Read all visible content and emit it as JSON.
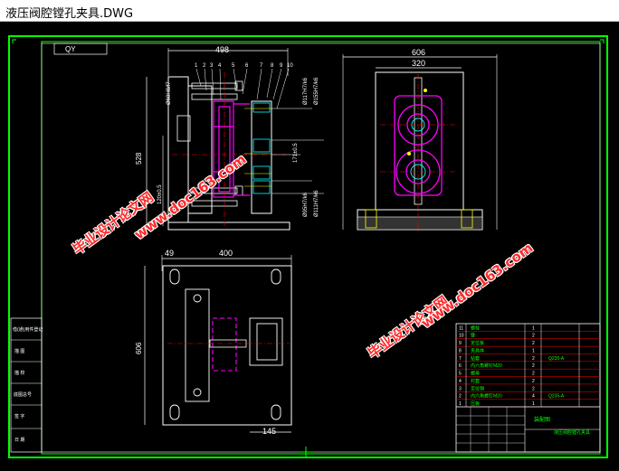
{
  "window": {
    "title": "液压阀腔镗孔夹具.DWG"
  },
  "drawing": {
    "view_label": "QY",
    "front_view": {
      "width_dim": "498",
      "height_dim": "528",
      "fits": [
        "Ø60H8/f7",
        "Ø117H7/k6",
        "Ø155H7/k6",
        "171±0.5",
        "Ø95H7/k6",
        "Ø111H7/k6",
        "120±0.5"
      ],
      "part_numbers": [
        "1",
        "2",
        "3",
        "4",
        "5",
        "6",
        "7",
        "8",
        "9",
        "10"
      ]
    },
    "side_view": {
      "outer_width": "606",
      "inner_width": "320"
    },
    "top_view": {
      "offset_dim": "49",
      "width_dim": "400",
      "height_dim": "606",
      "bottom_dim": "145"
    },
    "left_table_labels": [
      "借(通)用件登记",
      "描    图",
      "描    校",
      "底图总号",
      "签    字",
      "日    期"
    ],
    "bom_numbers": [
      "11",
      "10",
      "9",
      "8",
      "7",
      "6",
      "5",
      "4",
      "3",
      "2",
      "1"
    ],
    "bom_names": [
      "螺栓",
      "键",
      "定位板",
      "夹具体",
      "钻套",
      "内六角螺钉M20",
      "螺母",
      "衬套",
      "定位销",
      "内六角螺钉M20",
      "压板"
    ],
    "bom_qty": [
      "1",
      "2",
      "2",
      "1",
      "2",
      "2",
      "2",
      "2",
      "2",
      "4",
      "1"
    ],
    "bom_material": [
      "",
      "",
      "",
      "",
      "Q235-A",
      "",
      "",
      "",
      "",
      "Q235-A",
      ""
    ],
    "title_block": {
      "name": "装配图",
      "school": "液压阀腔镗孔夹具"
    }
  },
  "watermarks": {
    "text1": "毕业设计论文网",
    "url": "www.doc163.com"
  },
  "colors": {
    "line_white": "#ffffff",
    "green": "#00ff00",
    "magenta": "#ff00ff",
    "cyan": "#00ffff",
    "red": "#ff0000",
    "yellow": "#ffff00"
  }
}
